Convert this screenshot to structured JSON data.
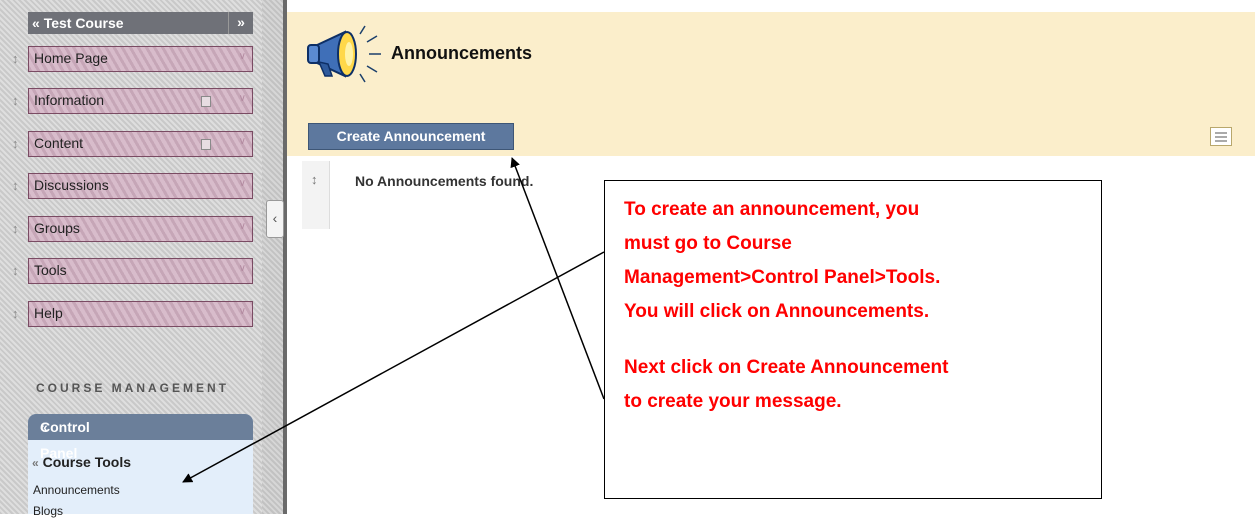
{
  "sidebar": {
    "course_title": "Test Course",
    "expand_icon": "double-chevron-right",
    "menu": [
      {
        "label": "Home Page"
      },
      {
        "label": "Information"
      },
      {
        "label": "Content"
      },
      {
        "label": "Discussions"
      },
      {
        "label": "Groups"
      },
      {
        "label": "Tools"
      },
      {
        "label": "Help"
      }
    ],
    "course_management_label": "COURSE MANAGEMENT",
    "control_panel": {
      "title": "Control Panel",
      "section": "Course Tools",
      "items": [
        "Announcements",
        "Blogs"
      ]
    }
  },
  "main": {
    "title": "Announcements",
    "create_button": "Create Announcement",
    "empty_message": "No Announcements found."
  },
  "callout": {
    "lines": [
      "To create an announcement, you",
      "must go to Course",
      "Management>Control Panel>Tools.",
      "You will click on Announcements.",
      "Next click on Create Announcement",
      "to create your message."
    ],
    "text_color": "#ff0000"
  },
  "colors": {
    "menu_item": "#c6a6b7",
    "header_bg": "#fbeecb",
    "button_bg": "#5d789e",
    "control_panel_header": "#6b7f9a"
  }
}
